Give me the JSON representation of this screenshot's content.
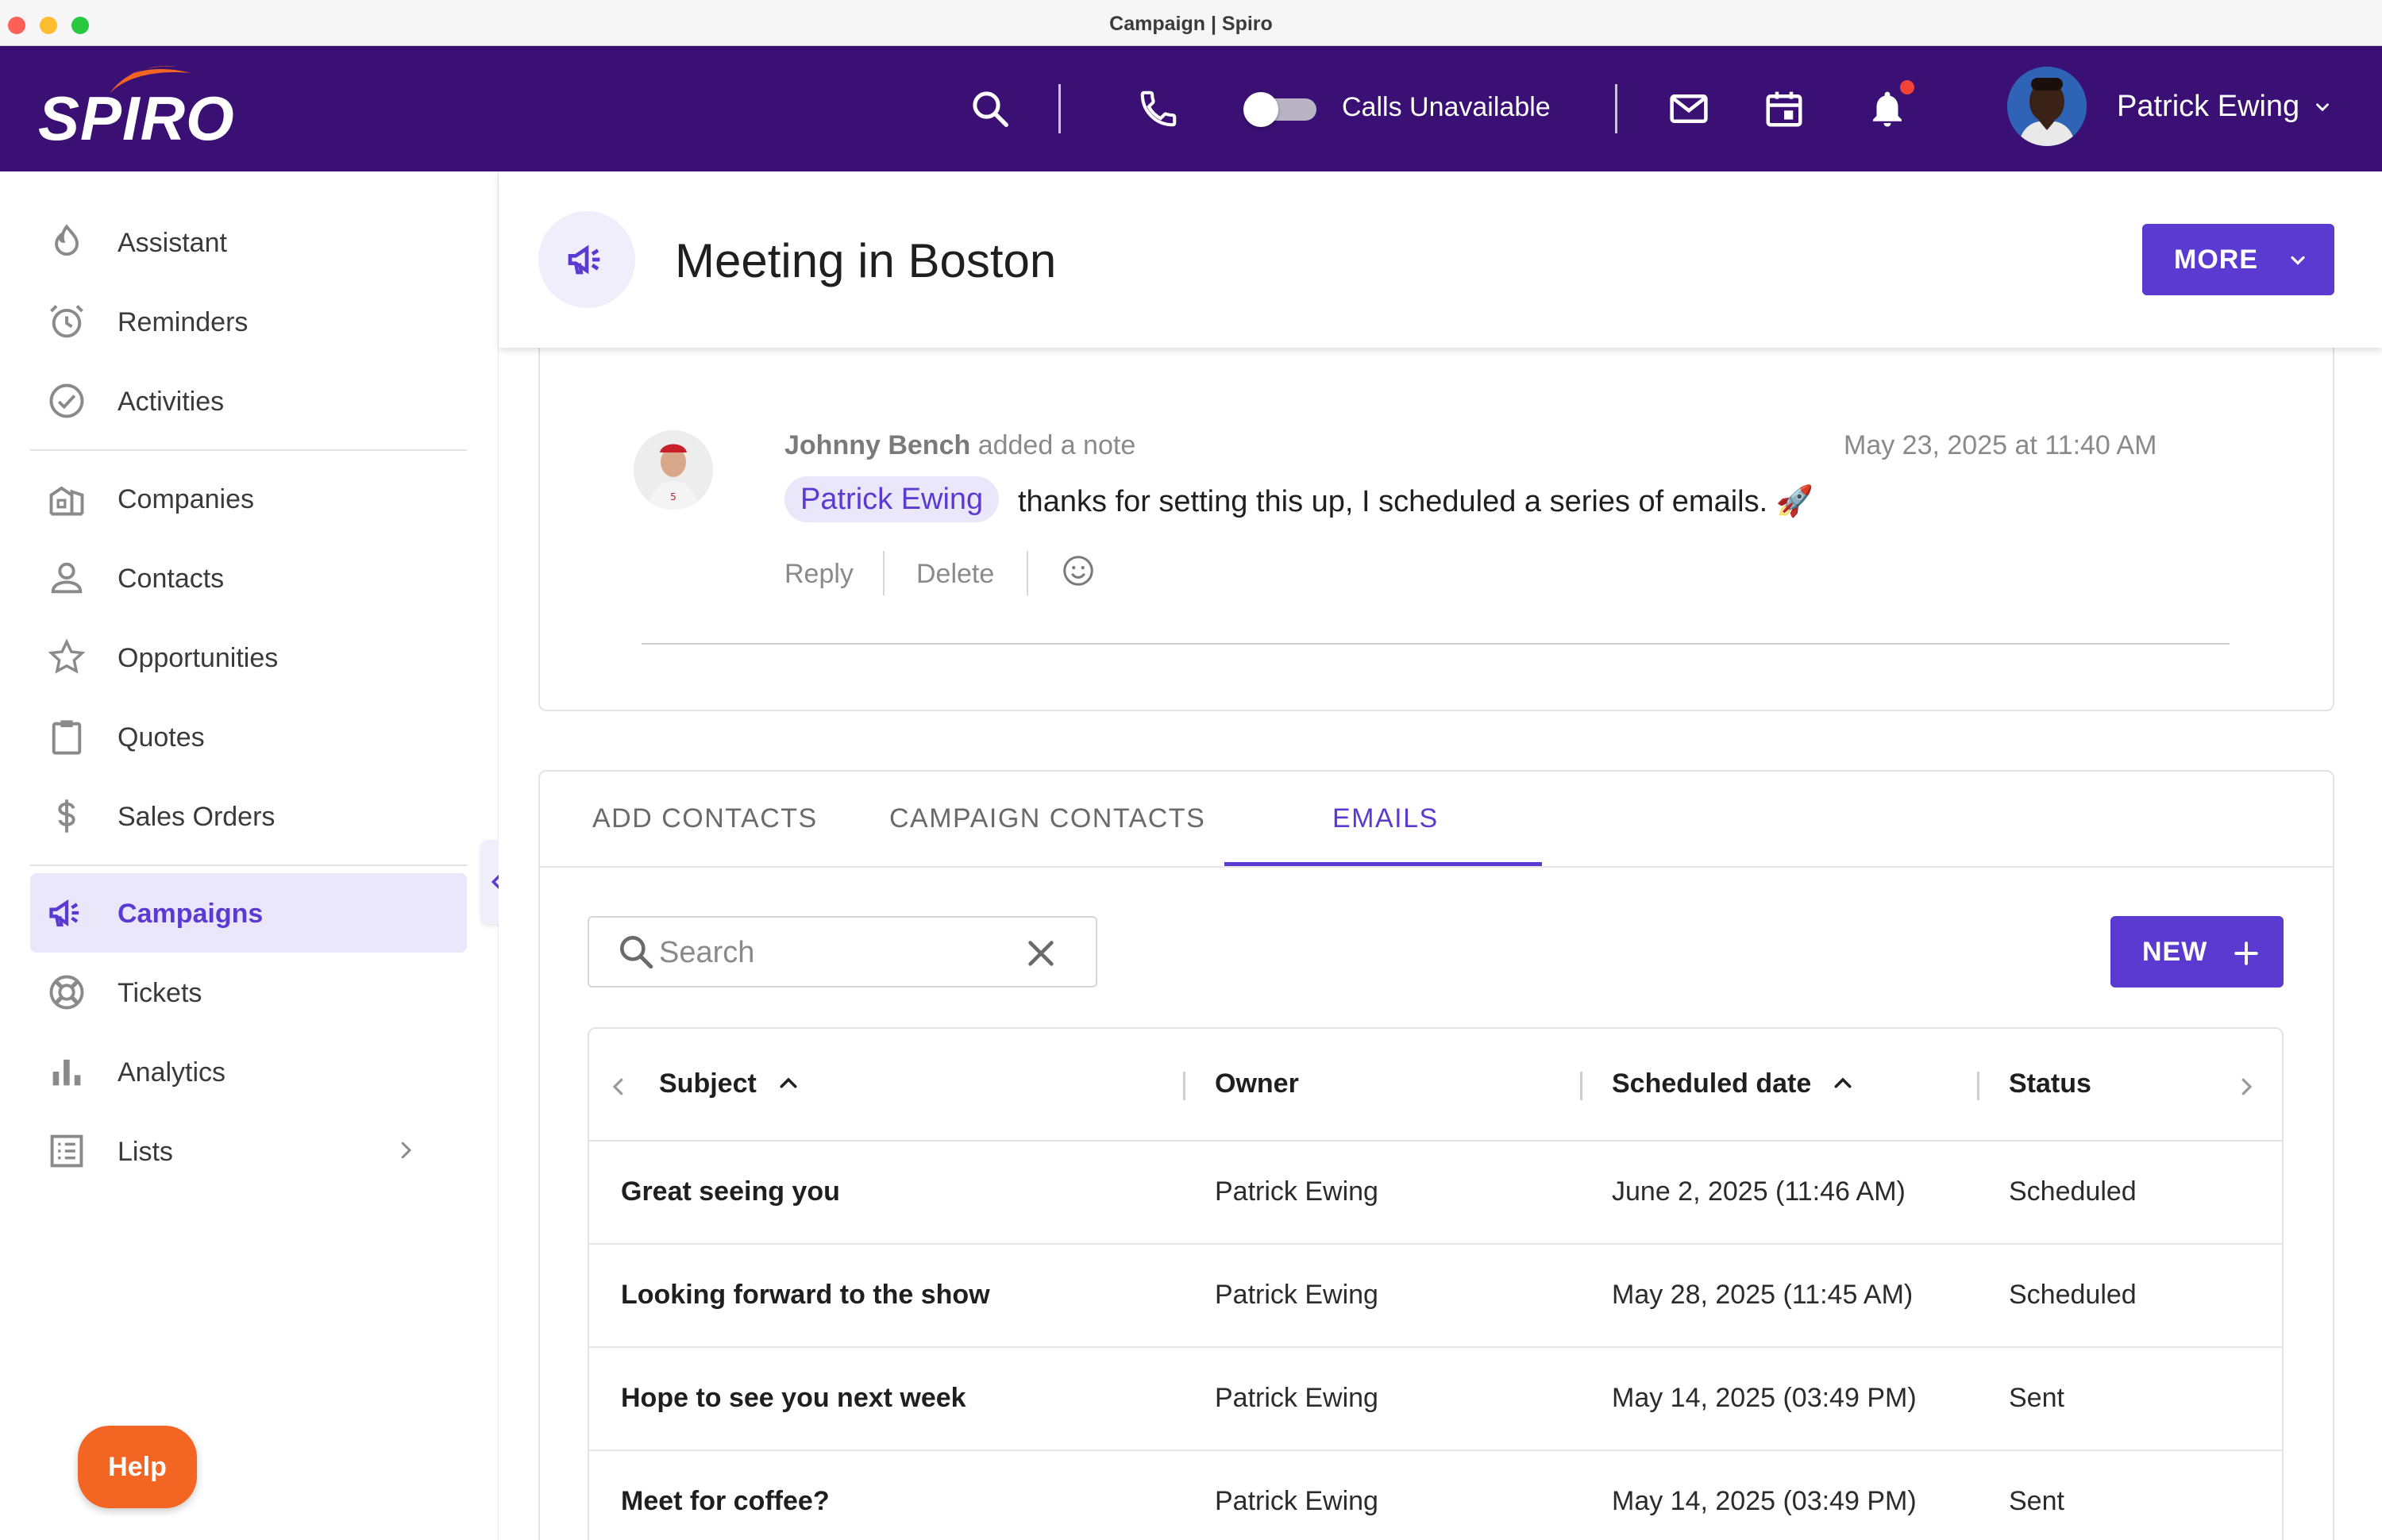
{
  "window": {
    "title": "Campaign | Spiro"
  },
  "topbar": {
    "logo_text": "SPIRO",
    "calls_label": "Calls Unavailable",
    "user_name": "Patrick Ewing",
    "icons": [
      "search-icon",
      "phone-icon",
      "toggle-switch",
      "mail-icon",
      "calendar-icon",
      "bell-icon"
    ]
  },
  "sidebar": {
    "items": [
      {
        "label": "Assistant",
        "icon": "assistant-icon"
      },
      {
        "label": "Reminders",
        "icon": "alarm-icon"
      },
      {
        "label": "Activities",
        "icon": "check-circle-icon"
      },
      {
        "label": "Companies",
        "icon": "building-icon"
      },
      {
        "label": "Contacts",
        "icon": "person-icon"
      },
      {
        "label": "Opportunities",
        "icon": "star-icon"
      },
      {
        "label": "Quotes",
        "icon": "clipboard-icon"
      },
      {
        "label": "Sales Orders",
        "icon": "dollar-icon"
      },
      {
        "label": "Campaigns",
        "icon": "megaphone-icon",
        "active": true
      },
      {
        "label": "Tickets",
        "icon": "lifebuoy-icon"
      },
      {
        "label": "Analytics",
        "icon": "bar-chart-icon"
      },
      {
        "label": "Lists",
        "icon": "list-icon"
      }
    ],
    "help_label": "Help"
  },
  "header": {
    "title": "Meeting in Boston",
    "more_label": "MORE"
  },
  "note": {
    "author": "Johnny Bench",
    "action": "added a note",
    "timestamp": "May 23, 2025 at 11:40 AM",
    "mention": "Patrick Ewing",
    "text": "thanks for setting this up, I scheduled a series of emails. 🚀",
    "reply_label": "Reply",
    "delete_label": "Delete"
  },
  "tabs": [
    {
      "label": "ADD CONTACTS"
    },
    {
      "label": "CAMPAIGN CONTACTS"
    },
    {
      "label": "EMAILS",
      "active": true
    }
  ],
  "search": {
    "placeholder": "Search",
    "value": ""
  },
  "new_label": "NEW",
  "table": {
    "columns": [
      "Subject",
      "Owner",
      "Scheduled date",
      "Status"
    ],
    "rows": [
      {
        "subject": "Great seeing you",
        "owner": "Patrick Ewing",
        "date": "June 2, 2025 (11:46 AM)",
        "status": "Scheduled"
      },
      {
        "subject": "Looking forward to the show",
        "owner": "Patrick Ewing",
        "date": "May 28, 2025 (11:45 AM)",
        "status": "Scheduled"
      },
      {
        "subject": "Hope to see you next week",
        "owner": "Patrick Ewing",
        "date": "May 14, 2025 (03:49 PM)",
        "status": "Sent"
      },
      {
        "subject": "Meet for coffee?",
        "owner": "Patrick Ewing",
        "date": "May 14, 2025 (03:49 PM)",
        "status": "Sent"
      }
    ]
  },
  "colors": {
    "brand_purple": "#3b1075",
    "accent": "#5a3ad0",
    "active_bg": "#ebe7fb",
    "help_orange": "#f26522"
  }
}
